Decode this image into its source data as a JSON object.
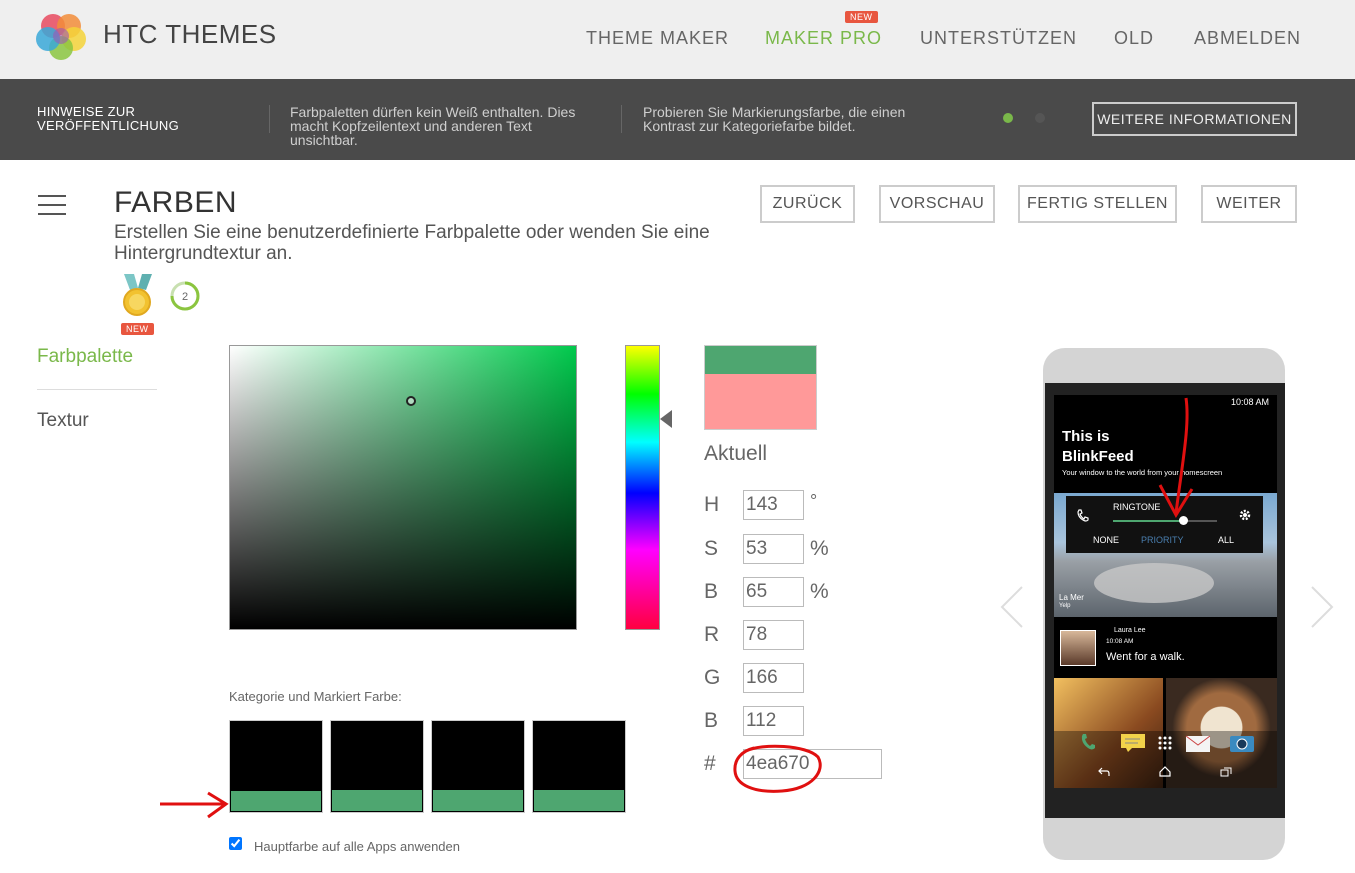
{
  "header": {
    "brand": "HTC THEMES",
    "nav": [
      "THEME MAKER",
      "MAKER PRO",
      "UNTERSTÜTZEN",
      "OLD",
      "ABMELDEN"
    ],
    "badge": "NEW"
  },
  "infobar": {
    "title": "HINWEISE ZUR VERÖFFENTLICHUNG",
    "tip1": "Farbpaletten dürfen kein Weiß enthalten. Dies macht Kopfzeilentext und anderen Text unsichtbar.",
    "tip2": "Probieren Sie Markierungsfarbe, die einen Kontrast zur Kategoriefarbe bildet.",
    "more": "WEITERE INFORMATIONEN"
  },
  "page": {
    "title": "FARBEN",
    "subtitle": "Erstellen Sie eine benutzerdefinierte Farbpalette oder wenden Sie eine Hintergrundtextur an.",
    "buttons": [
      "ZURÜCK",
      "VORSCHAU",
      "FERTIG STELLEN",
      "WEITER"
    ],
    "medal_badge": "NEW",
    "level": "2"
  },
  "sidebar": {
    "items": [
      "Farbpalette",
      "Textur"
    ]
  },
  "picker": {
    "current_label": "Aktuell",
    "fields": [
      {
        "label": "H",
        "value": "143",
        "unit": "°"
      },
      {
        "label": "S",
        "value": "53",
        "unit": "%"
      },
      {
        "label": "B",
        "value": "65",
        "unit": "%"
      },
      {
        "label": "R",
        "value": "78",
        "unit": ""
      },
      {
        "label": "G",
        "value": "166",
        "unit": ""
      },
      {
        "label": "B",
        "value": "112",
        "unit": ""
      }
    ],
    "hex_label": "#",
    "hex_value": "4ea670",
    "new_color": "#4ea670",
    "old_color": "#ff9999"
  },
  "swatches": {
    "label": "Kategorie und Markiert Farbe:",
    "accent": "#4ea670",
    "apply_label": "Hauptfarbe auf alle Apps anwenden",
    "apply_checked": true
  },
  "phone": {
    "time": "10:08 AM",
    "feed_title_1": "This is",
    "feed_title_2": "BlinkFeed",
    "feed_sub": "Your window to the world from your homescreen",
    "ringtone_label": "RINGTONE",
    "volume_options": [
      "NONE",
      "PRIORITY",
      "ALL"
    ],
    "place": "La Mer",
    "place_source": "Yelp",
    "post_author": "Laura Lee",
    "post_time": "10:08 AM",
    "post_text": "Went for a walk."
  }
}
